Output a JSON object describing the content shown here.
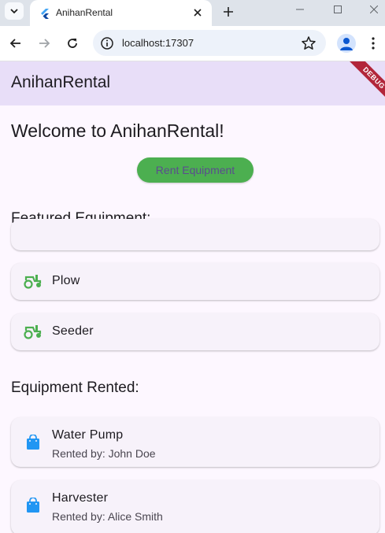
{
  "browser": {
    "tab_title": "AnihanRental",
    "url": "localhost:17307"
  },
  "app": {
    "title": "AnihanRental",
    "debug_banner": "DEBUG",
    "welcome": "Welcome to AnihanRental!",
    "rent_button": "Rent Equipment",
    "featured_heading": "Featured Equipment:",
    "featured_items": [
      {
        "label": "Plow",
        "icon": "tractor-icon"
      },
      {
        "label": "Seeder",
        "icon": "tractor-icon"
      }
    ],
    "rented_heading": "Equipment Rented:",
    "rented_items": [
      {
        "label": "Water Pump",
        "sub": "Rented by: John Doe",
        "icon": "shopping-bag-icon"
      },
      {
        "label": "Harvester",
        "sub": "Rented by: Alice Smith",
        "icon": "shopping-bag-icon"
      }
    ]
  },
  "colors": {
    "appbar": "#e8def8",
    "background": "#fdf7ff",
    "card": "#f7f2fa",
    "button": "#4caf50",
    "tractor_icon": "#4caf50",
    "bag_icon": "#2196f3"
  }
}
